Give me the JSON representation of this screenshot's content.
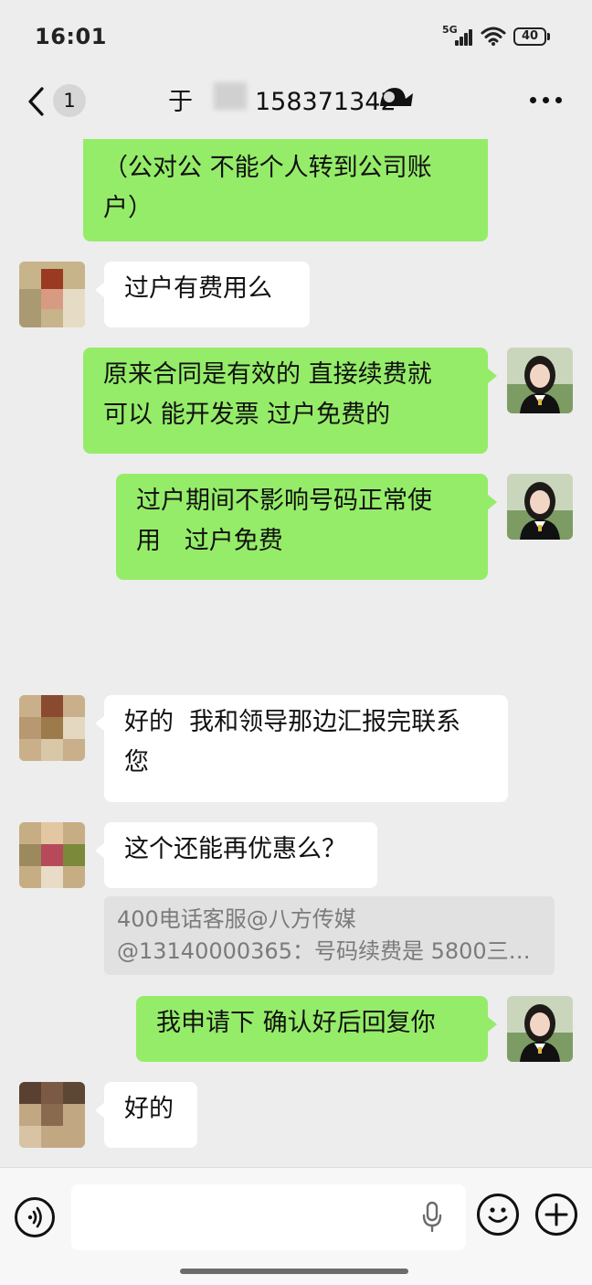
{
  "status_bar": {
    "time": "16:01",
    "network": "5G",
    "battery": "40"
  },
  "header": {
    "back_icon": "chevron-left-icon",
    "unread_count": "1",
    "title_prefix": "于",
    "title_number": "15837134",
    "title_suffix": "2",
    "more_icon": "ellipsis-icon"
  },
  "colors": {
    "mine_bubble": "#95ec69",
    "their_bubble": "#ffffff",
    "background": "#ededed"
  },
  "messages": [
    {
      "side": "mine",
      "text_lines": [
        "（公对公 不能个人转到公司账",
        "户）"
      ]
    },
    {
      "side": "theirs",
      "text_lines": [
        "过户有费用么"
      ]
    },
    {
      "side": "mine",
      "text_lines": [
        "原来合同是有效的 直接续费就",
        "可以 能开发票 过户免费的"
      ]
    },
    {
      "side": "mine",
      "text_lines": [
        "过户期间不影响号码正常使",
        "用   过户免费"
      ]
    },
    {
      "side": "theirs",
      "text_lines": [
        "好的  我和领导那边汇报完联系",
        "您"
      ]
    },
    {
      "side": "theirs",
      "text_lines": [
        "这个还能再优惠么？"
      ]
    },
    {
      "side": "mine",
      "text_lines": [
        "我申请下 确认好后回复你"
      ]
    },
    {
      "side": "theirs",
      "text_lines": [
        "好的"
      ]
    }
  ],
  "quote": {
    "line1": "400电话客服@八方传媒",
    "line2": "@13140000365：号码续费是 5800三…"
  },
  "input_bar": {
    "voice_icon": "voice-icon",
    "mic_icon": "microphone-icon",
    "emoji_icon": "emoji-icon",
    "plus_icon": "plus-icon",
    "text": ""
  }
}
